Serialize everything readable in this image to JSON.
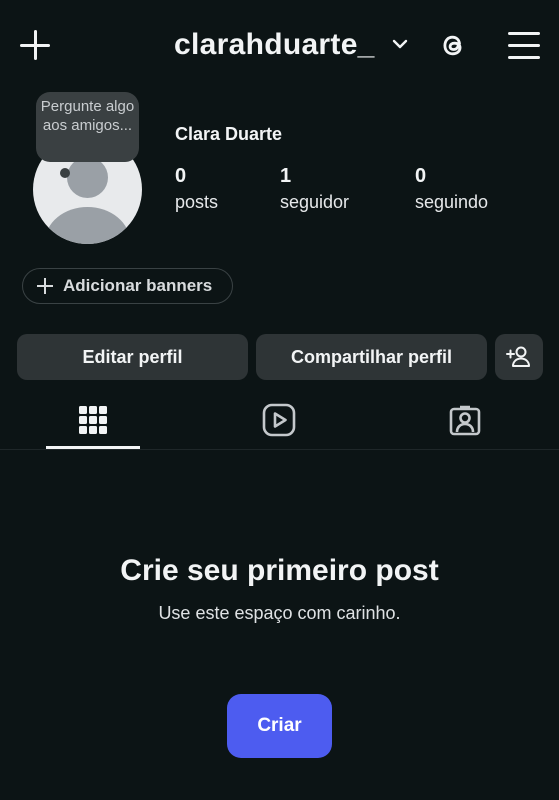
{
  "header": {
    "username": "clarahduarte_",
    "icons": [
      "plus-icon",
      "chevron-down-icon",
      "threads-icon",
      "hamburger-menu-icon"
    ]
  },
  "profile": {
    "note_bubble": "Pergunte algo aos amigos...",
    "display_name": "Clara Duarte",
    "stats": [
      {
        "value": "0",
        "label": "posts"
      },
      {
        "value": "1",
        "label": "seguidor"
      },
      {
        "value": "0",
        "label": "seguindo"
      }
    ]
  },
  "banner_button": {
    "label": "Adicionar banners"
  },
  "actions": {
    "edit_profile": "Editar perfil",
    "share_profile": "Compartilhar perfil"
  },
  "tabs": [
    {
      "icon": "grid-icon",
      "selected": true
    },
    {
      "icon": "reels-icon",
      "selected": false
    },
    {
      "icon": "tagged-person-icon",
      "selected": false
    }
  ],
  "empty_state": {
    "title": "Crie seu primeiro post",
    "subtitle": "Use este espaço com carinho.",
    "button": "Criar"
  },
  "colors": {
    "background": "#0c1415",
    "button_bg": "#2e3436",
    "accent": "#4d5cf0",
    "text": "#f2f4f5"
  }
}
